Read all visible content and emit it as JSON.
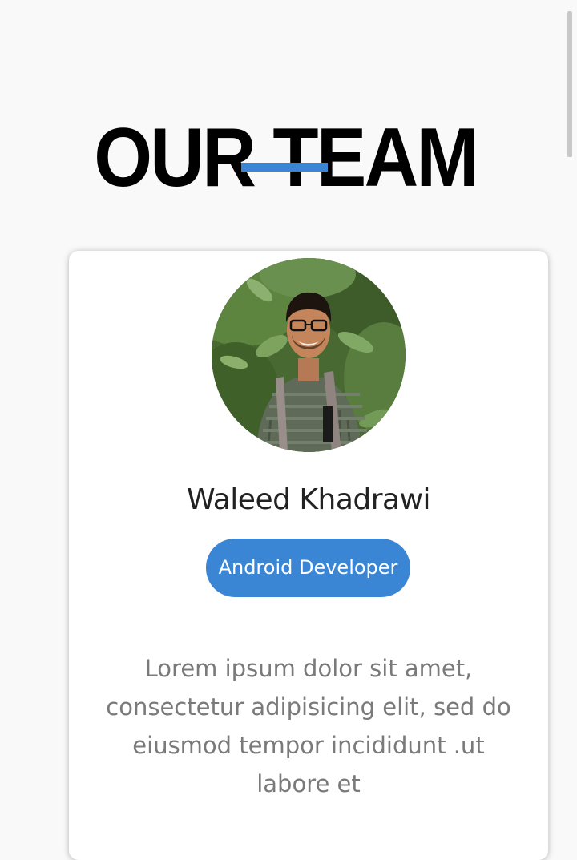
{
  "page": {
    "title": "OUR TEAM"
  },
  "theme": {
    "accent_color": "#3a86d4",
    "background_color": "#f9f9f9"
  },
  "member": {
    "avatar_icon": "profile-photo",
    "name": "Waleed Khadrawi",
    "role": "Android Developer",
    "description": "Lorem ipsum dolor sit amet, consectetur adipisicing elit, sed do eiusmod tempor incididunt .ut labore et"
  }
}
